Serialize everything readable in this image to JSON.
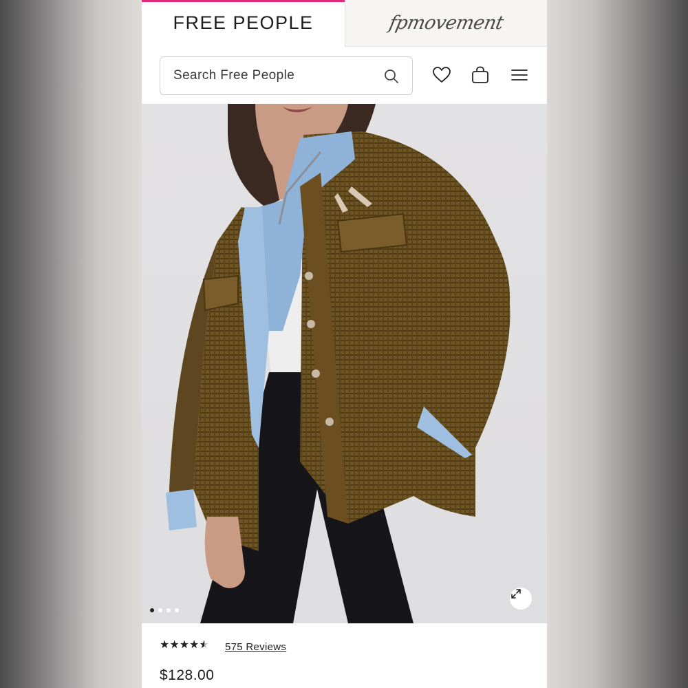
{
  "brand_tabs": {
    "free_people": "FREE PEOPLE",
    "fp_movement": "fpmovement",
    "accent_color": "#e0287a"
  },
  "header": {
    "search_placeholder": "Search Free People",
    "icons": [
      "search-icon",
      "heart-icon",
      "bag-icon",
      "menu-icon"
    ]
  },
  "product": {
    "image_dots": {
      "count": 4,
      "active": 1
    },
    "rating": 4.5,
    "reviews_label": "575 Reviews",
    "price": "$128.00"
  }
}
